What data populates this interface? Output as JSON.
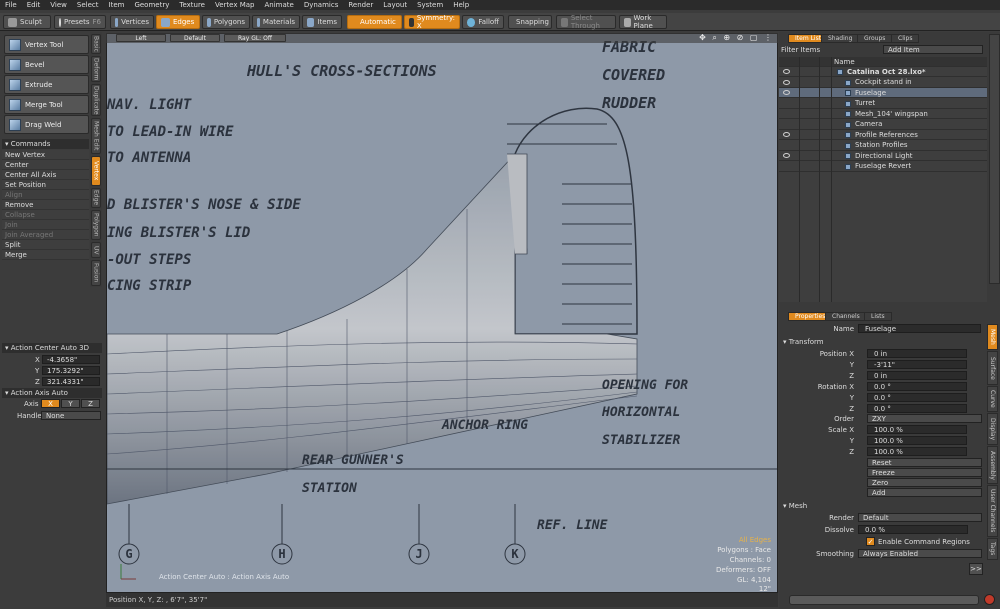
{
  "menu": [
    "File",
    "Edit",
    "View",
    "Select",
    "Item",
    "Geometry",
    "Texture",
    "Vertex Map",
    "Animate",
    "Dynamics",
    "Render",
    "Layout",
    "System",
    "Help"
  ],
  "toolbar": {
    "sculpt": "Sculpt",
    "presets": "Presets",
    "presets_key": "F6",
    "vertices": "Vertices",
    "edges": "Edges",
    "polygons": "Polygons",
    "materials": "Materials",
    "items": "Items",
    "automatic": "Automatic",
    "symmetry": "Symmetry: X",
    "falloff": "Falloff",
    "snapping": "Snapping",
    "select_through": "Select Through",
    "work_plane": "Work Plane"
  },
  "left_tabs": [
    "Basic",
    "Deform",
    "Duplicate",
    "Mesh Edit",
    "Vertex",
    "Edge",
    "Polygon",
    "UV",
    "Fusion"
  ],
  "tools": [
    "Vertex Tool",
    "Bevel",
    "Extrude",
    "Merge Tool",
    "Drag Weld"
  ],
  "commands": {
    "title": "Commands",
    "items": [
      {
        "label": "New Vertex",
        "enabled": true
      },
      {
        "label": "Center",
        "enabled": true
      },
      {
        "label": "Center All Axis",
        "enabled": true
      },
      {
        "label": "Set Position",
        "enabled": true
      },
      {
        "label": "Align",
        "enabled": false
      },
      {
        "label": "Remove",
        "enabled": true
      },
      {
        "label": "Collapse",
        "enabled": false
      },
      {
        "label": "Join",
        "enabled": false
      },
      {
        "label": "Join Averaged",
        "enabled": false
      },
      {
        "label": "Split",
        "enabled": true
      },
      {
        "label": "Merge",
        "enabled": true
      }
    ]
  },
  "action_center": {
    "title": "Action Center Auto 3D",
    "x": "-4.3658\"",
    "y": "175.3292\"",
    "z": "321.4331\""
  },
  "action_axis": {
    "title": "Action Axis Auto",
    "axis_label": "Axis",
    "axes": [
      "X",
      "Y",
      "Z"
    ],
    "handle_label": "Handle",
    "handle_value": "None"
  },
  "viewport": {
    "left_btn": "Left",
    "default_btn": "Default",
    "raygl_btn": "Ray GL: Off",
    "footer_label": "Action Center Auto : Action Axis Auto",
    "info": [
      "All Edges",
      "Polygons : Face",
      "Channels: 0",
      "Deformers: OFF",
      "GL: 4,104",
      "12\""
    ],
    "blueprint": {
      "title": "HULL'S CROSS-SECTIONS",
      "fabric": [
        "FABRIC",
        "COVERED",
        "RUDDER"
      ],
      "left_labels": [
        "NAV. LIGHT",
        "TO LEAD-IN WIRE",
        "TO ANTENNA",
        "D BLISTER'S NOSE & SIDE",
        "ING BLISTER'S LID",
        "-OUT STEPS",
        "CING STRIP"
      ],
      "opening": [
        "OPENING FOR",
        "HORIZONTAL",
        "STABILIZER"
      ],
      "anchor": "ANCHOR RING",
      "gunner": [
        "REAR GUNNER'S",
        "STATION"
      ],
      "ref": "REF. LINE",
      "stations": [
        "G",
        "H",
        "J",
        "K"
      ]
    }
  },
  "status": "Position X, Y, Z: , 6'7\", 35'7\"",
  "item_list": {
    "tabs": [
      "Item List",
      "Shading",
      "Groups",
      "Clips"
    ],
    "filter_label": "Filter Items",
    "add_label": "Add Item",
    "name_col": "Name",
    "rows": [
      {
        "name": "Catalina Oct 28.lxo*",
        "selected": false,
        "eye": true,
        "indent": 0
      },
      {
        "name": "Cockpit stand in",
        "selected": false,
        "eye": true,
        "indent": 1
      },
      {
        "name": "Fuselage",
        "selected": true,
        "eye": true,
        "indent": 1
      },
      {
        "name": "Turret",
        "selected": false,
        "eye": false,
        "indent": 1
      },
      {
        "name": "Mesh_104' wingspan",
        "selected": false,
        "eye": false,
        "indent": 1
      },
      {
        "name": "Camera",
        "selected": false,
        "eye": false,
        "indent": 1
      },
      {
        "name": "Profile References",
        "selected": false,
        "eye": true,
        "indent": 1
      },
      {
        "name": "Station Profiles",
        "selected": false,
        "eye": false,
        "indent": 1
      },
      {
        "name": "Directional Light",
        "selected": false,
        "eye": true,
        "indent": 1
      },
      {
        "name": "Fuselage Revert",
        "selected": false,
        "eye": false,
        "indent": 1
      }
    ]
  },
  "properties": {
    "tabs": [
      "Properties",
      "Channels",
      "Lists"
    ],
    "side_tabs": [
      "Mesh",
      "Surface",
      "Curve",
      "Display",
      "Assembly",
      "User Channels",
      "Tags"
    ],
    "name_label": "Name",
    "name_value": "Fuselage",
    "transform_title": "Transform",
    "position_label": "Position",
    "rotation_label": "Rotation",
    "scale_label": "Scale",
    "pos": [
      "0 in",
      "-3'11\"",
      "0 in"
    ],
    "rot": [
      "0.0 °",
      "0.0 °",
      "0.0 °"
    ],
    "order_label": "Order",
    "order_value": "ZXY",
    "scale": [
      "100.0 %",
      "100.0 %",
      "100.0 %"
    ],
    "actions": [
      "Reset",
      "Freeze",
      "Zero",
      "Add"
    ],
    "mesh_title": "Mesh",
    "render_label": "Render",
    "render_value": "Default",
    "dissolve_label": "Dissolve",
    "dissolve_value": "0.0 %",
    "command_regions": "Enable Command Regions",
    "smoothing_label": "Smoothing",
    "smoothing_value": "Always Enabled",
    "more_btn": ">>"
  }
}
